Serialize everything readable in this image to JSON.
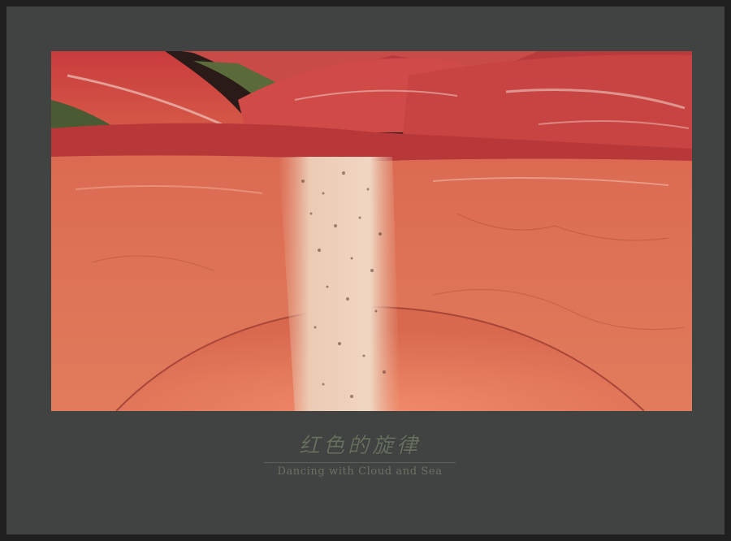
{
  "photo": {
    "subject-icon": "red-sandstone-rock-channel",
    "colors": {
      "border_outer": "#1f1f1f",
      "frame": "#414343",
      "rock_light": "#e07a5a",
      "rock_deep": "#c9403a",
      "stripe": "#e8c8b0"
    }
  },
  "caption": {
    "title": "红色的旋律",
    "subtitle": "Dancing with Cloud and Sea"
  }
}
